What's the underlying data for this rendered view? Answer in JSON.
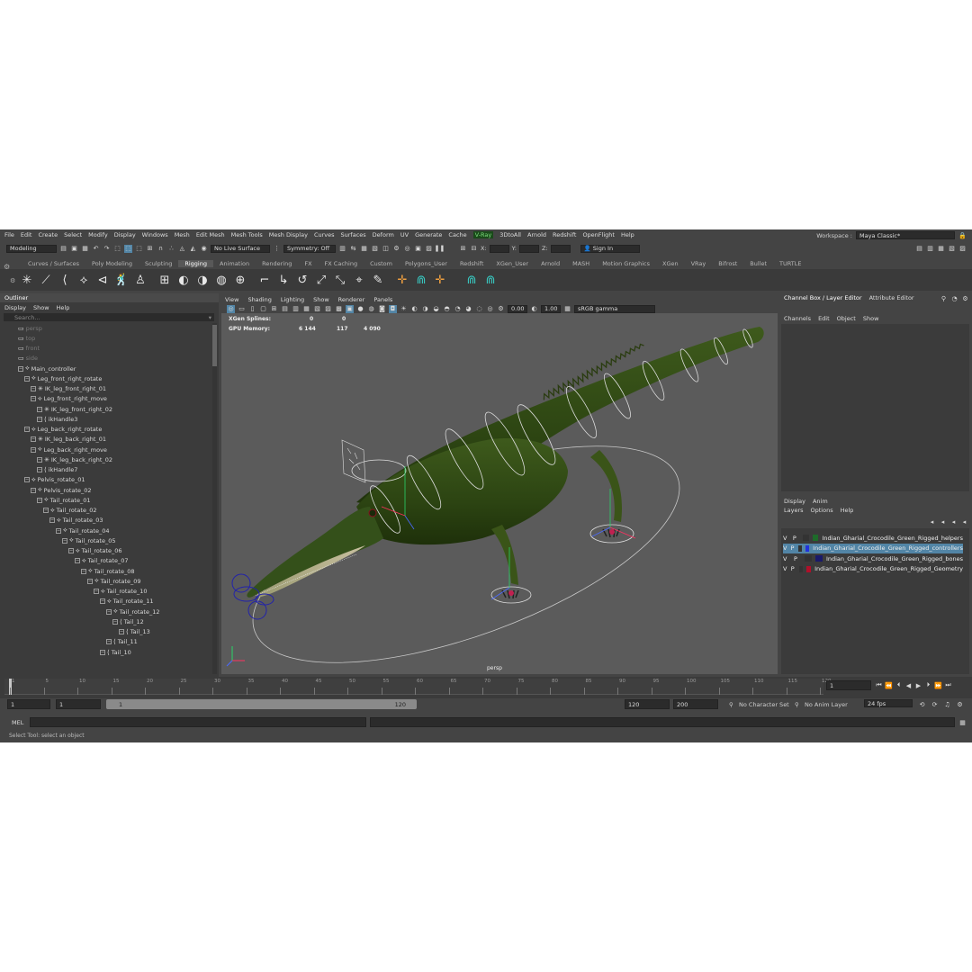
{
  "menus": [
    "File",
    "Edit",
    "Create",
    "Select",
    "Modify",
    "Display",
    "Windows",
    "Mesh",
    "Edit Mesh",
    "Mesh Tools",
    "Mesh Display",
    "Curves",
    "Surfaces",
    "Deform",
    "UV",
    "Generate",
    "Cache",
    "V-Ray",
    "3DtoAll",
    "Arnold",
    "Redshift",
    "OpenFlight",
    "Help"
  ],
  "workspace": {
    "label": "Workspace :",
    "value": "Maya Classic*"
  },
  "status": {
    "mode": "Modeling",
    "live_surface": "No Live Surface",
    "symmetry": "Symmetry: Off",
    "x_label": "X:",
    "y_label": "Y:",
    "z_label": "Z:",
    "sign_in": "Sign In"
  },
  "shelf_tabs": [
    "Curves / Surfaces",
    "Poly Modeling",
    "Sculpting",
    "Rigging",
    "Animation",
    "Rendering",
    "FX",
    "FX Caching",
    "Custom",
    "Polygons_User",
    "Redshift",
    "XGen_User",
    "Arnold",
    "MASH",
    "Motion Graphics",
    "XGen",
    "VRay",
    "Bifrost",
    "Bullet",
    "TURTLE"
  ],
  "outliner": {
    "title": "Outliner",
    "menu": [
      "Display",
      "Show",
      "Help"
    ],
    "search_placeholder": "Search...",
    "items": [
      {
        "label": "persp",
        "depth": 0,
        "dim": true
      },
      {
        "label": "top",
        "depth": 0,
        "dim": true
      },
      {
        "label": "front",
        "depth": 0,
        "dim": true
      },
      {
        "label": "side",
        "depth": 0,
        "dim": true
      },
      {
        "label": "Main_controller",
        "depth": 0
      },
      {
        "label": "Leg_front_right_rotate",
        "depth": 1
      },
      {
        "label": "IK_leg_front_right_01",
        "depth": 2
      },
      {
        "label": "Leg_front_right_move",
        "depth": 2
      },
      {
        "label": "IK_leg_front_right_02",
        "depth": 3
      },
      {
        "label": "ikHandle3",
        "depth": 3
      },
      {
        "label": "Leg_back_right_rotate",
        "depth": 1
      },
      {
        "label": "IK_leg_back_right_01",
        "depth": 2
      },
      {
        "label": "Leg_back_right_move",
        "depth": 2
      },
      {
        "label": "IK_leg_back_right_02",
        "depth": 3
      },
      {
        "label": "ikHandle7",
        "depth": 3
      },
      {
        "label": "Pelvis_rotate_01",
        "depth": 1
      },
      {
        "label": "Pelvis_rotate_02",
        "depth": 2
      },
      {
        "label": "Tail_rotate_01",
        "depth": 3
      },
      {
        "label": "Tail_rotate_02",
        "depth": 4
      },
      {
        "label": "Tail_rotate_03",
        "depth": 5
      },
      {
        "label": "Tail_rotate_04",
        "depth": 6
      },
      {
        "label": "Tail_rotate_05",
        "depth": 7
      },
      {
        "label": "Tail_rotate_06",
        "depth": 8
      },
      {
        "label": "Tail_rotate_07",
        "depth": 9
      },
      {
        "label": "Tail_rotate_08",
        "depth": 10
      },
      {
        "label": "Tail_rotate_09",
        "depth": 11
      },
      {
        "label": "Tail_rotate_10",
        "depth": 12
      },
      {
        "label": "Tail_rotate_11",
        "depth": 13
      },
      {
        "label": "Tail_rotate_12",
        "depth": 14
      },
      {
        "label": "Tail_12",
        "depth": 15
      },
      {
        "label": "Tail_13",
        "depth": 16
      },
      {
        "label": "Tail_11",
        "depth": 14
      },
      {
        "label": "Tail_10",
        "depth": 13
      }
    ]
  },
  "viewport": {
    "menu": [
      "View",
      "Shading",
      "Lighting",
      "Show",
      "Renderer",
      "Panels"
    ],
    "exposure": "0.00",
    "gamma": "1.00",
    "colorspace": "sRGB gamma",
    "hud": [
      {
        "label": "XGen Splines:",
        "a": "0",
        "b": "0",
        "c": ""
      },
      {
        "label": "GPU Memory:",
        "a": "6 144",
        "b": "117",
        "c": "4 090"
      }
    ],
    "camera": "persp"
  },
  "channel_box": {
    "tabs": [
      "Channel Box / Layer Editor",
      "Attribute Editor"
    ],
    "menu": [
      "Channels",
      "Edit",
      "Object",
      "Show"
    ]
  },
  "layer_editor": {
    "tabs": [
      "Display",
      "Anim"
    ],
    "menu": [
      "Layers",
      "Options",
      "Help"
    ],
    "layers": [
      {
        "v": "V",
        "p": "P",
        "name": "Indian_Gharial_Crocodile_Green_Rigged_helpers",
        "color": "#1e6b2a",
        "selected": false
      },
      {
        "v": "V",
        "p": "P",
        "name": "Indian_Gharial_Crocodile_Green_Rigged_controllers",
        "color": "#2233dd",
        "selected": true
      },
      {
        "v": "V",
        "p": "P",
        "name": "Indian_Gharial_Crocodile_Green_Rigged_bones",
        "color": "#1a1a6a",
        "selected": false
      },
      {
        "v": "V",
        "p": "P",
        "name": "Indian_Gharial_Crocodile_Green_Rigged_Geometry",
        "color": "#b0102a",
        "selected": false
      }
    ]
  },
  "timeline": {
    "ticks": [
      "1",
      "5",
      "10",
      "15",
      "20",
      "25",
      "30",
      "35",
      "40",
      "45",
      "50",
      "55",
      "60",
      "65",
      "70",
      "75",
      "80",
      "85",
      "90",
      "95",
      "100",
      "105",
      "110",
      "115",
      "120"
    ],
    "current_frame": "1"
  },
  "range": {
    "start": "1",
    "start2": "1",
    "slider_start": "1",
    "slider_end": "120",
    "end": "120",
    "end2": "200",
    "character": "No Character Set",
    "anim_layer": "No Anim Layer",
    "fps": "24 fps"
  },
  "command": {
    "label": "MEL"
  },
  "help_line": "Select Tool: select an object"
}
